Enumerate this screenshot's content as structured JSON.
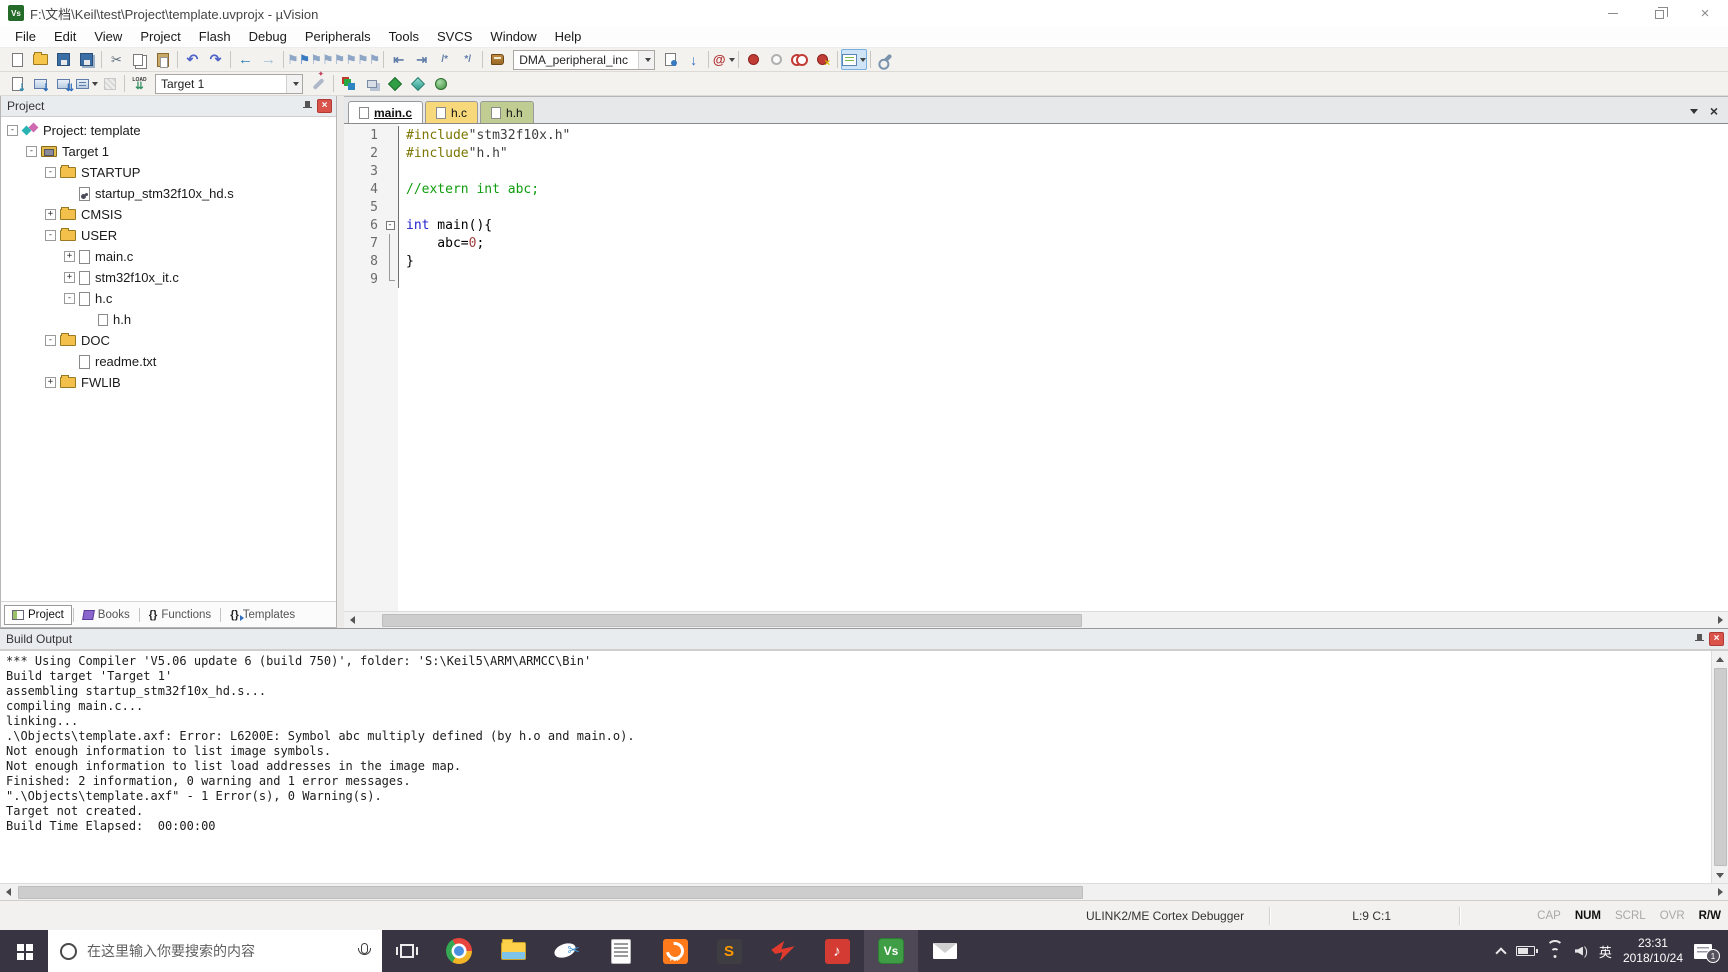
{
  "window": {
    "title": "F:\\文档\\Keil\\test\\Project\\template.uvprojx - µVision"
  },
  "menu": {
    "items": [
      "File",
      "Edit",
      "View",
      "Project",
      "Flash",
      "Debug",
      "Peripherals",
      "Tools",
      "SVCS",
      "Window",
      "Help"
    ]
  },
  "toolbar1": {
    "left": [
      "new-file",
      "open-file",
      "save",
      "save-all",
      "sep",
      "cut",
      "copy",
      "paste",
      "sep",
      "undo",
      "redo",
      "sep",
      "navigate-back",
      "navigate-forward",
      "sep",
      "bookmark-toggle",
      "bookmark-previous",
      "bookmark-next",
      "bookmark-clear",
      "sep",
      "unindent",
      "indent",
      "comment",
      "uncomment",
      "sep",
      "source-browser"
    ],
    "find_value": "DMA_peripheral_inc",
    "right": [
      "find-in-files",
      "incremental-find",
      "sep",
      "search",
      "sep",
      "breakpoint-insert",
      "breakpoint-toggle-enable",
      "breakpoint-kill-all",
      "breakpoint-disable-all",
      "sep",
      "views-dropdown",
      "sep",
      "configuration"
    ]
  },
  "toolbar2": {
    "left": [
      "translate",
      "build",
      "rebuild",
      "batch-build",
      "stop-build",
      "sep",
      "download"
    ],
    "target_value": "Target 1",
    "right": [
      "options-for-target",
      "sep",
      "manage-project-items",
      "file-extensions",
      "manage-rte",
      "pack-installer",
      "software-packs"
    ]
  },
  "project_panel": {
    "title": "Project",
    "tree": [
      {
        "depth": 0,
        "expander": "minus",
        "icon": "project",
        "label": "Project: template"
      },
      {
        "depth": 1,
        "expander": "minus",
        "icon": "target",
        "label": "Target 1"
      },
      {
        "depth": 2,
        "expander": "minus",
        "icon": "folder",
        "label": "STARTUP"
      },
      {
        "depth": 3,
        "expander": "none",
        "icon": "asm-file",
        "label": "startup_stm32f10x_hd.s"
      },
      {
        "depth": 2,
        "expander": "plus",
        "icon": "folder",
        "label": "CMSIS"
      },
      {
        "depth": 2,
        "expander": "minus",
        "icon": "folder",
        "label": "USER"
      },
      {
        "depth": 3,
        "expander": "plus",
        "icon": "c-file",
        "label": "main.c"
      },
      {
        "depth": 3,
        "expander": "plus",
        "icon": "c-file",
        "label": "stm32f10x_it.c"
      },
      {
        "depth": 3,
        "expander": "minus",
        "icon": "c-file",
        "label": "h.c"
      },
      {
        "depth": 4,
        "expander": "none",
        "icon": "h-file",
        "label": "h.h"
      },
      {
        "depth": 2,
        "expander": "minus",
        "icon": "folder",
        "label": "DOC"
      },
      {
        "depth": 3,
        "expander": "none",
        "icon": "txt-file",
        "label": "readme.txt"
      },
      {
        "depth": 2,
        "expander": "plus",
        "icon": "folder",
        "label": "FWLIB"
      }
    ],
    "bottom_tabs": [
      {
        "label": "Project",
        "icon": "bt-proj",
        "active": true
      },
      {
        "label": "Books",
        "icon": "bt-books",
        "active": false
      },
      {
        "label": "Functions",
        "icon": "bt-fn",
        "active": false
      },
      {
        "label": "Templates",
        "icon": "bt-tpl",
        "active": false
      }
    ]
  },
  "editor": {
    "tabs": [
      {
        "label": "main.c",
        "active": true,
        "color": "#ffffff"
      },
      {
        "label": "h.c",
        "active": false,
        "color": "#f7d97b"
      },
      {
        "label": "h.h",
        "active": false,
        "color": "#bfcd92"
      }
    ],
    "lines": [
      {
        "num": "1",
        "fold": "",
        "segs": [
          [
            "pre",
            "#include"
          ],
          [
            "str",
            "\"stm32f10x.h\""
          ]
        ]
      },
      {
        "num": "2",
        "fold": "",
        "segs": [
          [
            "pre",
            "#include"
          ],
          [
            "str",
            "\"h.h\""
          ]
        ]
      },
      {
        "num": "3",
        "fold": "",
        "segs": []
      },
      {
        "num": "4",
        "fold": "",
        "segs": [
          [
            "com",
            "//extern int abc;"
          ]
        ]
      },
      {
        "num": "5",
        "fold": "",
        "segs": []
      },
      {
        "num": "6",
        "fold": "box",
        "segs": [
          [
            "kw",
            "int"
          ],
          [
            "pln",
            " main(){"
          ]
        ]
      },
      {
        "num": "7",
        "fold": "line",
        "segs": [
          [
            "pln",
            "    abc="
          ],
          [
            "num",
            "0"
          ],
          [
            "pln",
            ";"
          ]
        ]
      },
      {
        "num": "8",
        "fold": "line",
        "segs": [
          [
            "pln",
            "}"
          ]
        ]
      },
      {
        "num": "9",
        "fold": "end",
        "segs": []
      }
    ]
  },
  "build_output": {
    "title": "Build Output",
    "lines": [
      "*** Using Compiler 'V5.06 update 6 (build 750)', folder: 'S:\\Keil5\\ARM\\ARMCC\\Bin'",
      "Build target 'Target 1'",
      "assembling startup_stm32f10x_hd.s...",
      "compiling main.c...",
      "linking...",
      ".\\Objects\\template.axf: Error: L6200E: Symbol abc multiply defined (by h.o and main.o).",
      "Not enough information to list image symbols.",
      "Not enough information to list load addresses in the image map.",
      "Finished: 2 information, 0 warning and 1 error messages.",
      "\".\\Objects\\template.axf\" - 1 Error(s), 0 Warning(s).",
      "Target not created.",
      "Build Time Elapsed:  00:00:00"
    ]
  },
  "status_bar": {
    "debugger": "ULINK2/ME Cortex Debugger",
    "cursor": "L:9 C:1",
    "indicators": [
      {
        "label": "CAP",
        "on": false
      },
      {
        "label": "NUM",
        "on": true
      },
      {
        "label": "SCRL",
        "on": false
      },
      {
        "label": "OVR",
        "on": false
      },
      {
        "label": "R/W",
        "on": true
      }
    ]
  },
  "taskbar": {
    "search_placeholder": "在这里输入你要搜索的内容",
    "ime": "英",
    "time": "23:31",
    "date": "2018/10/24",
    "notification_count": "1"
  }
}
